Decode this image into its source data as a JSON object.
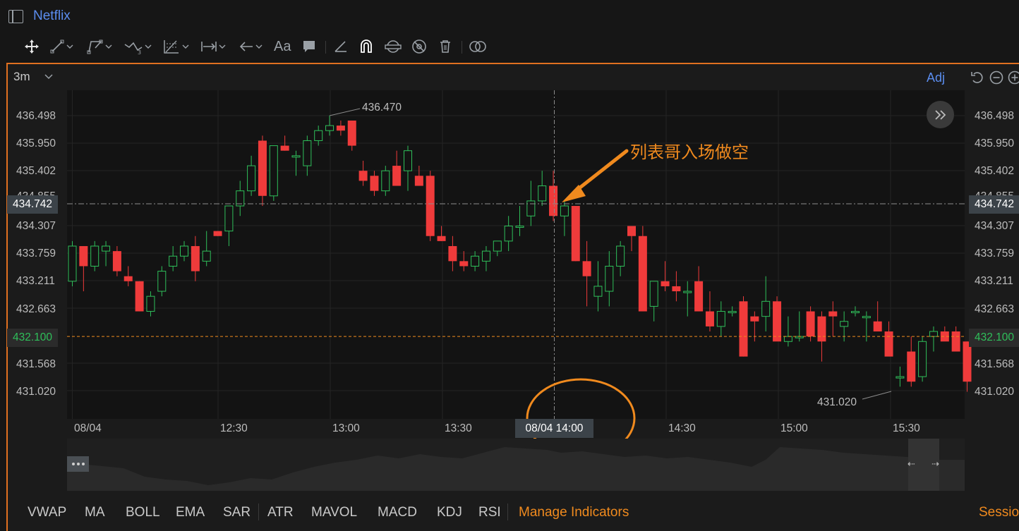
{
  "app": {
    "title": "Netflix"
  },
  "toolbar": {
    "tools": [
      "move-tool",
      "trend-line-tool",
      "polyline-tool",
      "wave-tool",
      "fib-tool",
      "measure-tool",
      "arrow-tool",
      "text-tool",
      "comment-tool",
      "ruler-tool",
      "magnet-tool",
      "lock-tool",
      "hide-tool",
      "delete-tool",
      "compare-tool"
    ],
    "text_tool_label": "Aa"
  },
  "chart_header": {
    "interval": "3m",
    "adj_label": "Adj"
  },
  "y_axis": {
    "ticks": [
      "436.498",
      "435.950",
      "435.402",
      "434.307",
      "433.759",
      "433.211",
      "432.663",
      "431.568",
      "431.020"
    ],
    "partial_tick": "434.855",
    "crosshair_value": "434.742",
    "last_price": "432.100"
  },
  "x_axis": {
    "ticks": [
      "08/04",
      "12:30",
      "13:00",
      "13:30",
      "14:30",
      "15:00",
      "15:30"
    ],
    "crosshair_time": "08/04 14:00"
  },
  "annotations": {
    "high_label": "436.470",
    "low_label": "431.020",
    "note": "列表哥入场做空"
  },
  "indicators": {
    "items": [
      "VWAP",
      "MA",
      "BOLL",
      "EMA",
      "SAR",
      "ATR",
      "MAVOL",
      "MACD",
      "KDJ",
      "RSI"
    ],
    "manage": "Manage Indicators",
    "session": "Session"
  },
  "colors": {
    "up": "#2fbf5a",
    "down": "#ef3b3b",
    "accent": "#f08a1e",
    "link": "#5b8def"
  },
  "chart_data": {
    "type": "candlestick",
    "interval": "3m",
    "symbol": "Netflix",
    "ylim": [
      430.8,
      436.7
    ],
    "x": [
      "12:15",
      "12:18",
      "12:21",
      "12:24",
      "12:27",
      "12:30",
      "12:33",
      "12:36",
      "12:39",
      "12:42",
      "12:45",
      "12:48",
      "12:51",
      "12:54",
      "12:57",
      "13:00",
      "13:03",
      "13:06",
      "13:09",
      "13:12",
      "13:15",
      "13:18",
      "13:21",
      "13:24",
      "13:27",
      "13:30",
      "13:33",
      "13:36",
      "13:39",
      "13:42",
      "13:45",
      "13:48",
      "13:51",
      "13:54",
      "13:57",
      "14:00",
      "14:03",
      "14:06",
      "14:09",
      "14:12",
      "14:15",
      "14:18",
      "14:21",
      "14:24",
      "14:27",
      "14:30",
      "14:33",
      "14:36",
      "14:39",
      "14:42",
      "14:45",
      "14:48",
      "14:51",
      "14:54",
      "14:57",
      "15:00",
      "15:03",
      "15:06",
      "15:09",
      "15:12",
      "15:15",
      "15:18",
      "15:21",
      "15:24",
      "15:27",
      "15:30",
      "15:33",
      "15:36",
      "15:39",
      "15:42",
      "15:45",
      "15:48",
      "15:51",
      "15:54",
      "15:57",
      "16:00",
      "16:03",
      "16:09",
      "16:15",
      "16:21",
      "16:27"
    ],
    "ohlc": [
      [
        433.2,
        434.0,
        433.1,
        433.9
      ],
      [
        433.9,
        433.9,
        433.0,
        433.5
      ],
      [
        433.5,
        434.0,
        433.4,
        433.9
      ],
      [
        433.8,
        434.0,
        433.5,
        433.9
      ],
      [
        433.8,
        433.9,
        433.3,
        433.4
      ],
      [
        433.3,
        433.5,
        433.1,
        433.2
      ],
      [
        433.2,
        433.2,
        432.6,
        432.6
      ],
      [
        432.6,
        433.0,
        432.5,
        432.9
      ],
      [
        433.0,
        433.5,
        432.9,
        433.4
      ],
      [
        433.5,
        433.9,
        433.4,
        433.7
      ],
      [
        433.7,
        434.0,
        433.6,
        433.9
      ],
      [
        433.9,
        434.1,
        433.2,
        433.4
      ],
      [
        433.6,
        434.2,
        433.5,
        433.8
      ],
      [
        434.2,
        434.2,
        434.1,
        434.1
      ],
      [
        434.2,
        434.7,
        433.9,
        434.7
      ],
      [
        434.7,
        435.2,
        434.5,
        435.0
      ],
      [
        435.0,
        435.7,
        434.9,
        435.5
      ],
      [
        436.0,
        436.1,
        434.7,
        434.9
      ],
      [
        434.9,
        435.9,
        434.8,
        435.9
      ],
      [
        435.9,
        436.1,
        435.8,
        435.8
      ],
      [
        435.7,
        435.8,
        435.3,
        435.7
      ],
      [
        435.5,
        436.1,
        435.3,
        436.0
      ],
      [
        436.0,
        436.3,
        435.9,
        436.2
      ],
      [
        436.2,
        436.5,
        436.1,
        436.3
      ],
      [
        436.3,
        436.4,
        436.1,
        436.2
      ],
      [
        436.4,
        436.4,
        435.8,
        435.9
      ],
      [
        435.4,
        435.6,
        435.1,
        435.2
      ],
      [
        435.3,
        435.4,
        434.9,
        435.0
      ],
      [
        435.0,
        435.5,
        434.9,
        435.4
      ],
      [
        435.5,
        435.8,
        435.2,
        435.1
      ],
      [
        435.4,
        435.9,
        435.0,
        435.8
      ],
      [
        435.3,
        435.5,
        435.2,
        435.1
      ],
      [
        435.3,
        435.4,
        434.0,
        434.1
      ],
      [
        434.1,
        434.3,
        434.0,
        434.0
      ],
      [
        433.9,
        434.1,
        433.4,
        433.6
      ],
      [
        433.6,
        433.8,
        433.4,
        433.5
      ],
      [
        433.5,
        433.8,
        433.4,
        433.7
      ],
      [
        433.6,
        433.9,
        433.4,
        433.8
      ],
      [
        433.8,
        434.0,
        433.7,
        434.0
      ],
      [
        434.0,
        434.5,
        433.8,
        434.3
      ],
      [
        434.3,
        434.7,
        434.1,
        434.3
      ],
      [
        434.5,
        435.2,
        434.3,
        434.8
      ],
      [
        434.8,
        435.4,
        434.7,
        435.1
      ],
      [
        435.1,
        435.4,
        434.4,
        434.5
      ],
      [
        434.5,
        434.8,
        434.1,
        434.7
      ],
      [
        434.7,
        434.7,
        433.6,
        433.6
      ],
      [
        433.6,
        434.0,
        432.7,
        433.3
      ],
      [
        432.9,
        433.6,
        432.6,
        433.1
      ],
      [
        433.0,
        433.8,
        432.7,
        433.5
      ],
      [
        433.5,
        434.0,
        433.3,
        433.9
      ],
      [
        434.3,
        434.3,
        433.8,
        434.1
      ],
      [
        434.1,
        434.3,
        432.6,
        432.6
      ],
      [
        432.7,
        433.2,
        432.4,
        433.2
      ],
      [
        433.2,
        433.6,
        433.0,
        433.1
      ],
      [
        433.1,
        433.4,
        432.8,
        433.0
      ],
      [
        433.0,
        433.2,
        432.5,
        433.0
      ],
      [
        433.2,
        433.5,
        432.6,
        432.6
      ],
      [
        432.6,
        433.0,
        432.2,
        432.3
      ],
      [
        432.3,
        432.8,
        432.1,
        432.6
      ],
      [
        432.6,
        432.7,
        432.5,
        432.6
      ],
      [
        432.8,
        432.9,
        431.7,
        431.7
      ],
      [
        432.5,
        432.6,
        432.0,
        432.4
      ],
      [
        432.5,
        433.3,
        432.2,
        432.8
      ],
      [
        432.8,
        432.9,
        432.2,
        432.0
      ],
      [
        432.0,
        432.5,
        431.9,
        432.1
      ],
      [
        432.1,
        432.6,
        432.0,
        432.1
      ],
      [
        432.6,
        432.7,
        432.0,
        432.1
      ],
      [
        432.5,
        432.6,
        431.6,
        432.0
      ],
      [
        432.6,
        432.8,
        432.1,
        432.5
      ],
      [
        432.3,
        432.6,
        432.0,
        432.4
      ],
      [
        432.6,
        432.7,
        432.5,
        432.6
      ],
      [
        432.5,
        432.6,
        432.0,
        432.5
      ],
      [
        432.4,
        432.8,
        432.3,
        432.2
      ],
      [
        432.2,
        432.4,
        431.9,
        431.7
      ],
      [
        431.3,
        431.5,
        431.1,
        431.3
      ],
      [
        431.8,
        432.1,
        431.1,
        431.2
      ],
      [
        431.3,
        432.1,
        431.2,
        432.0
      ],
      [
        432.1,
        432.3,
        431.8,
        432.2
      ],
      [
        432.2,
        432.3,
        432.1,
        432.0
      ],
      [
        432.2,
        432.3,
        431.8,
        431.8
      ],
      [
        432.0,
        432.0,
        431.0,
        431.2
      ]
    ]
  }
}
